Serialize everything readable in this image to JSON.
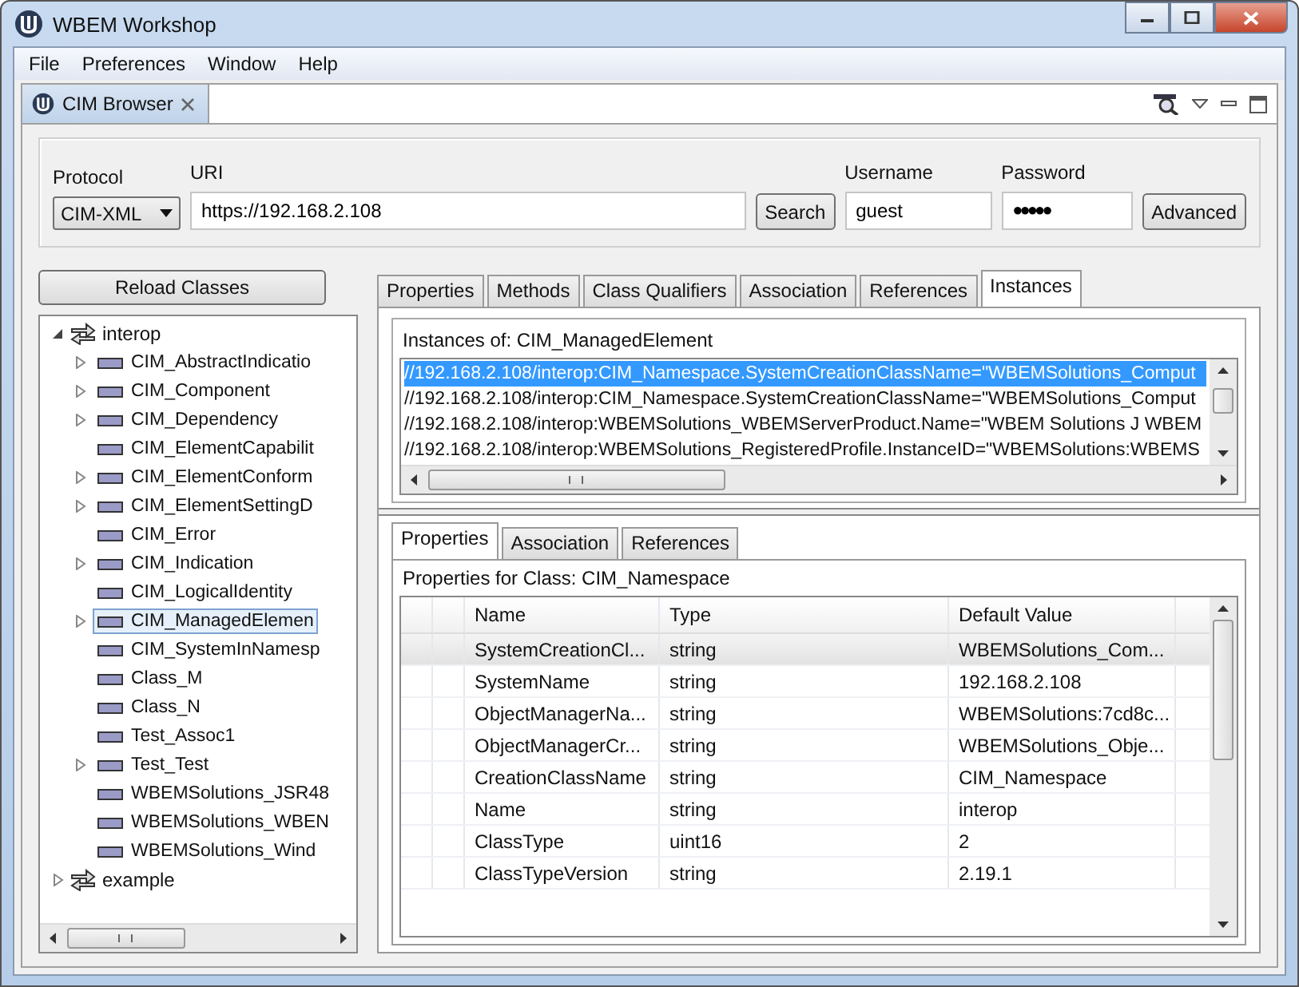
{
  "window": {
    "title": "WBEM Workshop"
  },
  "menu": [
    "File",
    "Preferences",
    "Window",
    "Help"
  ],
  "view_tab": {
    "label": "CIM Browser"
  },
  "connection": {
    "protocol_label": "Protocol",
    "protocol": "CIM-XML",
    "uri_label": "URI",
    "uri": "https://192.168.2.108",
    "search_button": "Search",
    "username_label": "Username",
    "username": "guest",
    "password_label": "Password",
    "password": "●●●●●",
    "advanced_button": "Advanced"
  },
  "reload_button": "Reload Classes",
  "tree": [
    {
      "label": "interop",
      "expandable": true,
      "expanded": true,
      "children": [
        {
          "label": "CIM_AbstractIndicatio",
          "expandable": true,
          "selected": false
        },
        {
          "label": "CIM_Component",
          "expandable": true,
          "selected": false
        },
        {
          "label": "CIM_Dependency",
          "expandable": true,
          "selected": false
        },
        {
          "label": "CIM_ElementCapabilit",
          "expandable": false,
          "selected": false
        },
        {
          "label": "CIM_ElementConform",
          "expandable": true,
          "selected": false
        },
        {
          "label": "CIM_ElementSettingD",
          "expandable": true,
          "selected": false
        },
        {
          "label": "CIM_Error",
          "expandable": false,
          "selected": false
        },
        {
          "label": "CIM_Indication",
          "expandable": true,
          "selected": false
        },
        {
          "label": "CIM_LogicalIdentity",
          "expandable": false,
          "selected": false
        },
        {
          "label": "CIM_ManagedElemen",
          "expandable": true,
          "selected": true
        },
        {
          "label": "CIM_SystemInNamesp",
          "expandable": false,
          "selected": false
        },
        {
          "label": "Class_M",
          "expandable": false,
          "selected": false
        },
        {
          "label": "Class_N",
          "expandable": false,
          "selected": false
        },
        {
          "label": "Test_Assoc1",
          "expandable": false,
          "selected": false
        },
        {
          "label": "Test_Test",
          "expandable": true,
          "selected": false
        },
        {
          "label": "WBEMSolutions_JSR48",
          "expandable": false,
          "selected": false
        },
        {
          "label": "WBEMSolutions_WBEN",
          "expandable": false,
          "selected": false
        },
        {
          "label": "WBEMSolutions_Wind",
          "expandable": false,
          "selected": false
        }
      ]
    },
    {
      "label": "example",
      "expandable": true,
      "expanded": false
    }
  ],
  "tabs": [
    {
      "label": "Properties",
      "selected": false
    },
    {
      "label": "Methods",
      "selected": false
    },
    {
      "label": "Class Qualifiers",
      "selected": false
    },
    {
      "label": "Association",
      "selected": false
    },
    {
      "label": "References",
      "selected": false
    },
    {
      "label": "Instances",
      "selected": true
    }
  ],
  "instances": {
    "heading": "Instances of: CIM_ManagedElement",
    "items": [
      {
        "text": "//192.168.2.108/interop:CIM_Namespace.SystemCreationClassName=\"WBEMSolutions_Comput",
        "selected": true
      },
      {
        "text": "//192.168.2.108/interop:CIM_Namespace.SystemCreationClassName=\"WBEMSolutions_Comput",
        "selected": false
      },
      {
        "text": "//192.168.2.108/interop:WBEMSolutions_WBEMServerProduct.Name=\"WBEM Solutions J WBEM",
        "selected": false
      },
      {
        "text": "//192.168.2.108/interop:WBEMSolutions_RegisteredProfile.InstanceID=\"WBEMSolutions:WBEMS",
        "selected": false
      }
    ]
  },
  "sub_tabs": [
    {
      "label": "Properties",
      "selected": true
    },
    {
      "label": "Association",
      "selected": false
    },
    {
      "label": "References",
      "selected": false
    }
  ],
  "properties": {
    "heading": "Properties for Class: CIM_Namespace",
    "columns": [
      "Name",
      "Type",
      "Default Value"
    ],
    "rows": [
      {
        "cells": [
          "SystemCreationCl...",
          "string",
          "WBEMSolutions_Com..."
        ],
        "selected": true
      },
      {
        "cells": [
          "SystemName",
          "string",
          "192.168.2.108"
        ],
        "selected": false
      },
      {
        "cells": [
          "ObjectManagerNa...",
          "string",
          "WBEMSolutions:7cd8c..."
        ],
        "selected": false
      },
      {
        "cells": [
          "ObjectManagerCr...",
          "string",
          "WBEMSolutions_Obje..."
        ],
        "selected": false
      },
      {
        "cells": [
          "CreationClassName",
          "string",
          "CIM_Namespace"
        ],
        "selected": false
      },
      {
        "cells": [
          "Name",
          "string",
          "interop"
        ],
        "selected": false
      },
      {
        "cells": [
          "ClassType",
          "uint16",
          "2"
        ],
        "selected": false
      },
      {
        "cells": [
          "ClassTypeVersion",
          "string",
          "2.19.1"
        ],
        "selected": false
      }
    ]
  }
}
